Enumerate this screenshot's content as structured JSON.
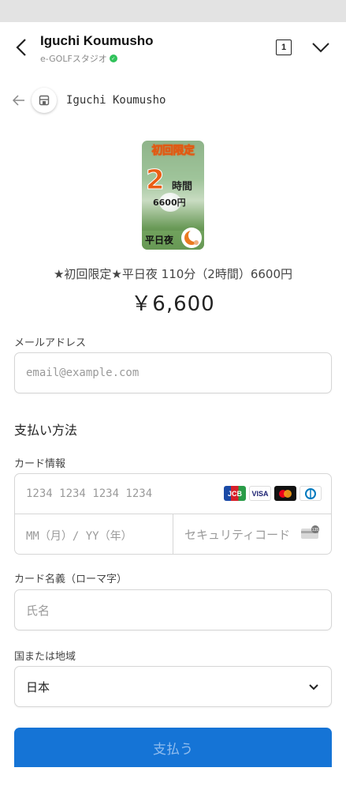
{
  "header": {
    "title": "Iguchi Koumusho",
    "subtitle": "e-GOLFスタジオ",
    "tab_count": "1"
  },
  "merchant": {
    "name": "Iguchi Koumusho"
  },
  "product_image": {
    "top_text": "初回限定",
    "big_number": "2",
    "unit": "時間",
    "price": "6600円",
    "bottom_text": "平日夜"
  },
  "product": {
    "title": "★初回限定★平日夜 110分（2時間）6600円",
    "price": "￥6,600"
  },
  "email": {
    "label": "メールアドレス",
    "placeholder": "email@example.com"
  },
  "payment": {
    "section_title": "支払い方法",
    "card_label": "カード情報",
    "card_number_placeholder": "1234 1234 1234 1234",
    "expiry_placeholder": "MM（月）/ YY（年）",
    "cvc_placeholder": "セキュリティコード",
    "brands": [
      "JCB",
      "VISA",
      "Mastercard",
      "Diners"
    ],
    "cardholder_label": "カード名義（ローマ字）",
    "cardholder_placeholder": "氏名",
    "country_label": "国または地域",
    "country_value": "日本"
  },
  "pay_button": {
    "label": "支払う"
  },
  "colors": {
    "accent": "#1574d6",
    "badge": "#31c25b",
    "product_orange": "#ea5e14"
  }
}
